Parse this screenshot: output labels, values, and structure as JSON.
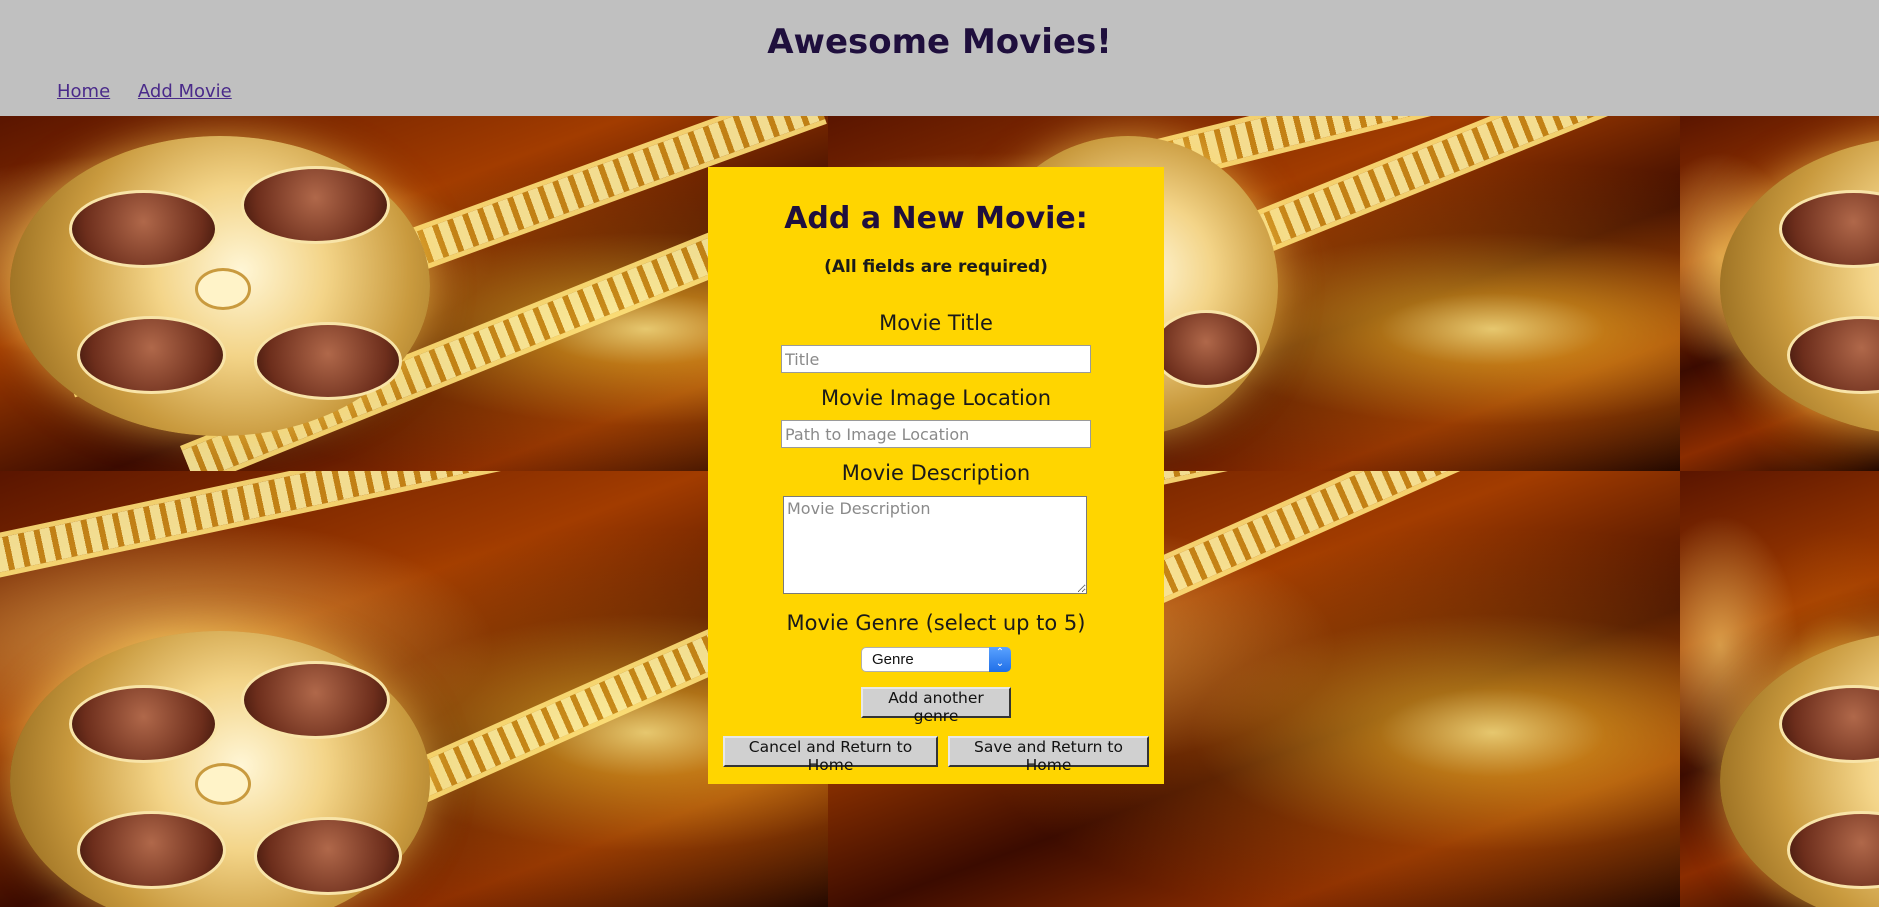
{
  "header": {
    "title": "Awesome Movies!"
  },
  "nav": {
    "items": [
      {
        "label": "Home"
      },
      {
        "label": "Add Movie"
      }
    ]
  },
  "form": {
    "heading": "Add a New Movie:",
    "subheading": "(All fields are required)",
    "title_label": "Movie Title",
    "title_placeholder": "Title",
    "image_label": "Movie Image Location",
    "image_placeholder": "Path to Image Location",
    "description_label": "Movie Description",
    "description_placeholder": "Movie Description",
    "genre_label": "Movie Genre (select up to 5)",
    "genre_selected": "Genre",
    "add_genre_label": "Add another genre",
    "cancel_label": "Cancel and Return to Home",
    "save_label": "Save and Return to Home"
  },
  "colors": {
    "header_bg": "#c0c0c0",
    "form_bg": "#ffd500",
    "title_color": "#1f0f3d",
    "link_color": "#4a2a8a"
  }
}
